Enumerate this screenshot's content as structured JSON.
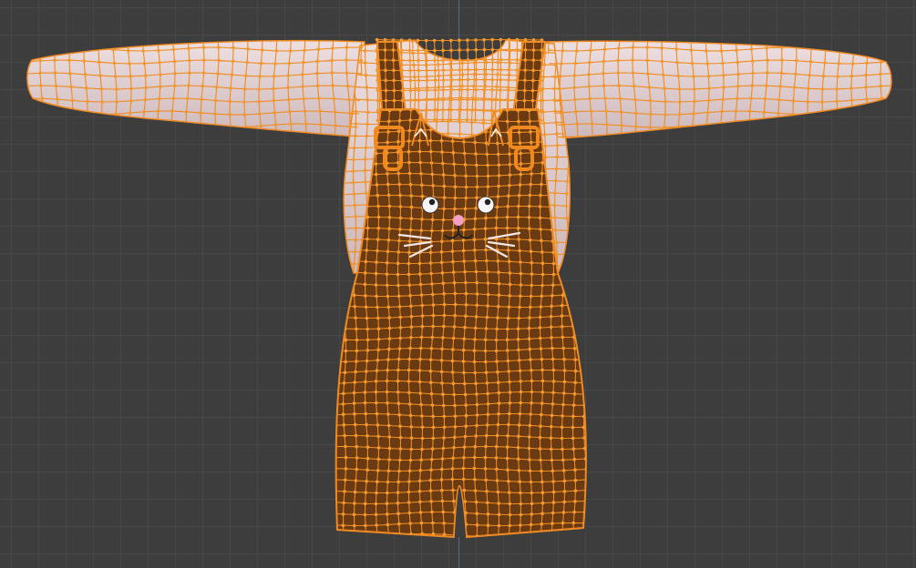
{
  "viewport": {
    "grid_color": "#474747",
    "background_color": "#3d3d3d",
    "y_axis_color": "#4a6f99"
  },
  "model": {
    "shirt_color": "#e4d4d6",
    "overall_color": "#6a3a12",
    "wire_color": "#ef8a23",
    "vertex_color": "#f39a2e",
    "buckle_color": "#f08a20",
    "face_icon": "cat-face-icon"
  }
}
